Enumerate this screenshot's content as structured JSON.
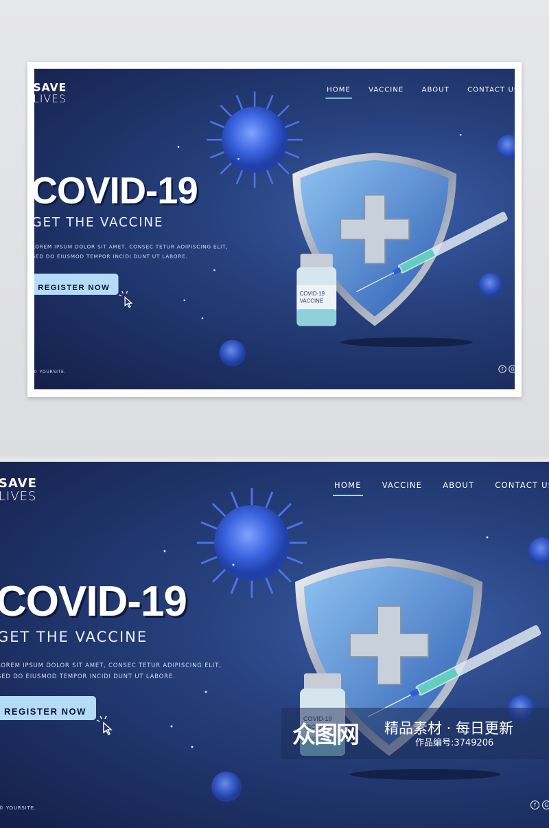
{
  "site": {
    "logo_line1": "SAVE",
    "logo_line2": "LIVES",
    "nav": [
      {
        "label": "HOME",
        "active": true
      },
      {
        "label": "VACCINE"
      },
      {
        "label": "ABOUT"
      },
      {
        "label": "CONTACT US"
      }
    ],
    "hero_title": "COVID-19",
    "hero_subtitle": "GET THE VACCINE",
    "lorem_line1": "LOREM IPSUM DOLOR SIT AMET, CONSEC TETUR ADIPISCING ELIT,",
    "lorem_line2": "SED DO EIUSMOD TEMPOR INCIDI DUNT UT LABORE.",
    "cta_label": "REGISTER NOW",
    "footer": "© YOURSITE.",
    "vial_label1": "COVID-19",
    "vial_label2": "VACCINE",
    "social": [
      {
        "icon": "facebook-icon",
        "glyph": "f"
      },
      {
        "icon": "google-icon",
        "glyph": "G"
      }
    ]
  },
  "watermark": {
    "logo": "众图网",
    "tagline": "精品素材 · 每日更新",
    "id_text": "作品编号:3749206"
  },
  "colors": {
    "background": "#1b2c5e",
    "accent": "#b4dcf8",
    "virus": "#3b63e0"
  }
}
